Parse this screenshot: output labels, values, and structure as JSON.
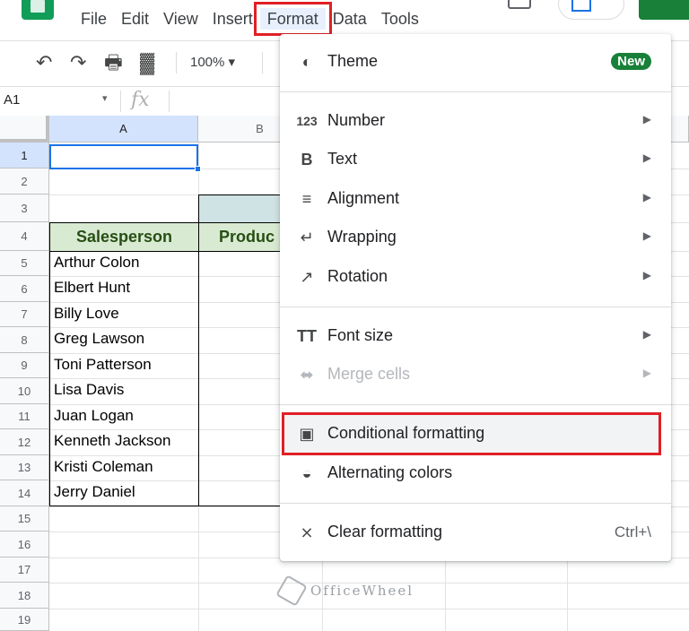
{
  "menubar": {
    "items": [
      "File",
      "Edit",
      "View",
      "Insert",
      "Format",
      "Data",
      "Tools"
    ],
    "active": "Format"
  },
  "toolbar": {
    "undo_icon": "undo-icon",
    "redo_icon": "redo-icon",
    "print_icon": "print-icon",
    "paint_format_icon": "paint-format-icon",
    "zoom": "100%"
  },
  "formula_bar": {
    "cell_ref": "A1",
    "fx": "fx",
    "value": ""
  },
  "grid": {
    "columns": [
      "A",
      "B"
    ],
    "rows": [
      "1",
      "2",
      "3",
      "4",
      "5",
      "6",
      "7",
      "8",
      "9",
      "10",
      "11",
      "12",
      "13",
      "14",
      "15",
      "16",
      "17",
      "18",
      "19"
    ],
    "header": {
      "a4": "Salesperson",
      "b4": "Produc"
    },
    "salespeople": [
      "Arthur Colon",
      "Elbert Hunt",
      "Billy Love",
      "Greg Lawson",
      "Toni Patterson",
      "Lisa Davis",
      "Juan Logan",
      "Kenneth Jackson",
      "Kristi Coleman",
      "Jerry Daniel"
    ],
    "selected_cell": "A1"
  },
  "format_menu": {
    "theme": {
      "label": "Theme",
      "icon": "palette-icon",
      "badge": "New"
    },
    "number": {
      "label": "Number",
      "icon": "123-icon"
    },
    "text": {
      "label": "Text",
      "icon": "bold-icon"
    },
    "alignment": {
      "label": "Alignment",
      "icon": "align-left-icon"
    },
    "wrapping": {
      "label": "Wrapping",
      "icon": "wrap-icon"
    },
    "rotation": {
      "label": "Rotation",
      "icon": "rotate-icon"
    },
    "font_size": {
      "label": "Font size",
      "icon": "text-size-icon"
    },
    "merge_cells": {
      "label": "Merge cells",
      "icon": "merge-icon",
      "disabled": true
    },
    "conditional_formatting": {
      "label": "Conditional formatting",
      "icon": "paint-roller-icon",
      "highlighted": true
    },
    "alternating_colors": {
      "label": "Alternating colors",
      "icon": "drop-icon"
    },
    "clear_formatting": {
      "label": "Clear formatting",
      "icon": "clear-format-icon",
      "shortcut": "Ctrl+\\"
    }
  },
  "watermark": "OfficeWheel",
  "colors": {
    "highlight_red": "#e11f26",
    "header_green_fill": "#d9ead3",
    "header_green_text": "#274e13",
    "badge_green": "#188038",
    "selection_blue": "#1a73e8"
  }
}
